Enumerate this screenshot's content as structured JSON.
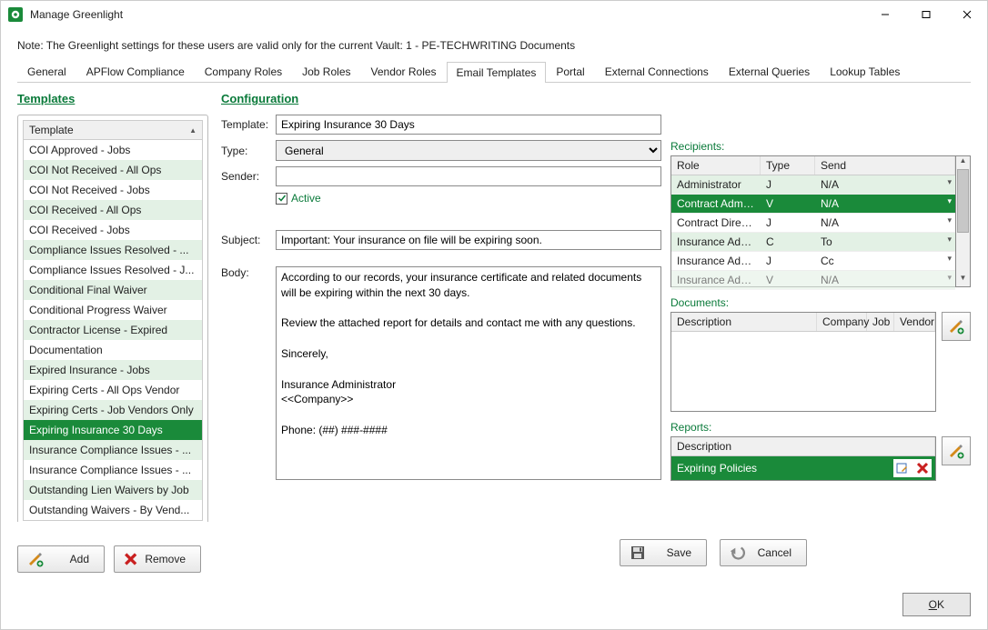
{
  "window": {
    "title": "Manage Greenlight"
  },
  "note": "Note:  The Greenlight settings for these users are valid only for the current Vault: 1 - PE-TECHWRITING Documents",
  "tabs": [
    {
      "label": "General"
    },
    {
      "label": "APFlow Compliance"
    },
    {
      "label": "Company Roles"
    },
    {
      "label": "Job Roles"
    },
    {
      "label": "Vendor Roles"
    },
    {
      "label": "Email Templates"
    },
    {
      "label": "Portal"
    },
    {
      "label": "External Connections"
    },
    {
      "label": "External Queries"
    },
    {
      "label": "Lookup Tables"
    }
  ],
  "headings": {
    "templates": "Templates",
    "configuration": "Configuration"
  },
  "template_col_header": "Template",
  "templates": [
    {
      "label": "COI Approved - Jobs"
    },
    {
      "label": "COI Not Received - All Ops"
    },
    {
      "label": "COI Not Received - Jobs"
    },
    {
      "label": "COI Received - All Ops"
    },
    {
      "label": "COI Received - Jobs"
    },
    {
      "label": "Compliance Issues Resolved - ..."
    },
    {
      "label": "Compliance Issues Resolved - J..."
    },
    {
      "label": "Conditional Final Waiver"
    },
    {
      "label": "Conditional Progress Waiver"
    },
    {
      "label": "Contractor License - Expired"
    },
    {
      "label": "Documentation"
    },
    {
      "label": "Expired Insurance - Jobs"
    },
    {
      "label": "Expiring Certs - All Ops Vendor"
    },
    {
      "label": "Expiring Certs - Job Vendors Only"
    },
    {
      "label": "Expiring Insurance 30 Days"
    },
    {
      "label": "Insurance Compliance Issues - ..."
    },
    {
      "label": "Insurance Compliance Issues - ..."
    },
    {
      "label": "Outstanding Lien Waivers by Job"
    },
    {
      "label": "Outstanding Waivers - By Vend..."
    }
  ],
  "buttons": {
    "add": "Add",
    "remove": "Remove",
    "save": "Save",
    "cancel": "Cancel",
    "ok": "OK"
  },
  "form": {
    "labels": {
      "template": "Template:",
      "type": "Type:",
      "sender": "Sender:",
      "active": "Active",
      "subject": "Subject:",
      "body": "Body:"
    },
    "template": "Expiring Insurance 30 Days",
    "type": "General",
    "sender": "",
    "active": true,
    "subject": "Important: Your insurance on file will be expiring soon.",
    "body": "According to our records, your insurance certificate and related documents will be expiring within the next 30 days.\n\nReview the attached report for details and contact me with any questions.\n\nSincerely,\n\nInsurance Administrator\n<<Company>>\n\nPhone: (##) ###-####"
  },
  "recipients": {
    "label": "Recipients:",
    "headers": {
      "role": "Role",
      "type": "Type",
      "send": "Send"
    },
    "rows": [
      {
        "role": "Administrator",
        "type": "J",
        "send": "N/A"
      },
      {
        "role": "Contract Administ...",
        "type": "V",
        "send": "N/A"
      },
      {
        "role": "Contract Director",
        "type": "J",
        "send": "N/A"
      },
      {
        "role": "Insurance Admini...",
        "type": "C",
        "send": "To"
      },
      {
        "role": "Insurance Admini...",
        "type": "J",
        "send": "Cc"
      },
      {
        "role": "Insurance Admini...",
        "type": "V",
        "send": "N/A"
      }
    ]
  },
  "documents": {
    "label": "Documents:",
    "headers": {
      "description": "Description",
      "company": "Company",
      "job": "Job",
      "vendor": "Vendor"
    }
  },
  "reports": {
    "label": "Reports:",
    "header": "Description",
    "rows": [
      {
        "label": "Expiring Policies"
      }
    ]
  }
}
